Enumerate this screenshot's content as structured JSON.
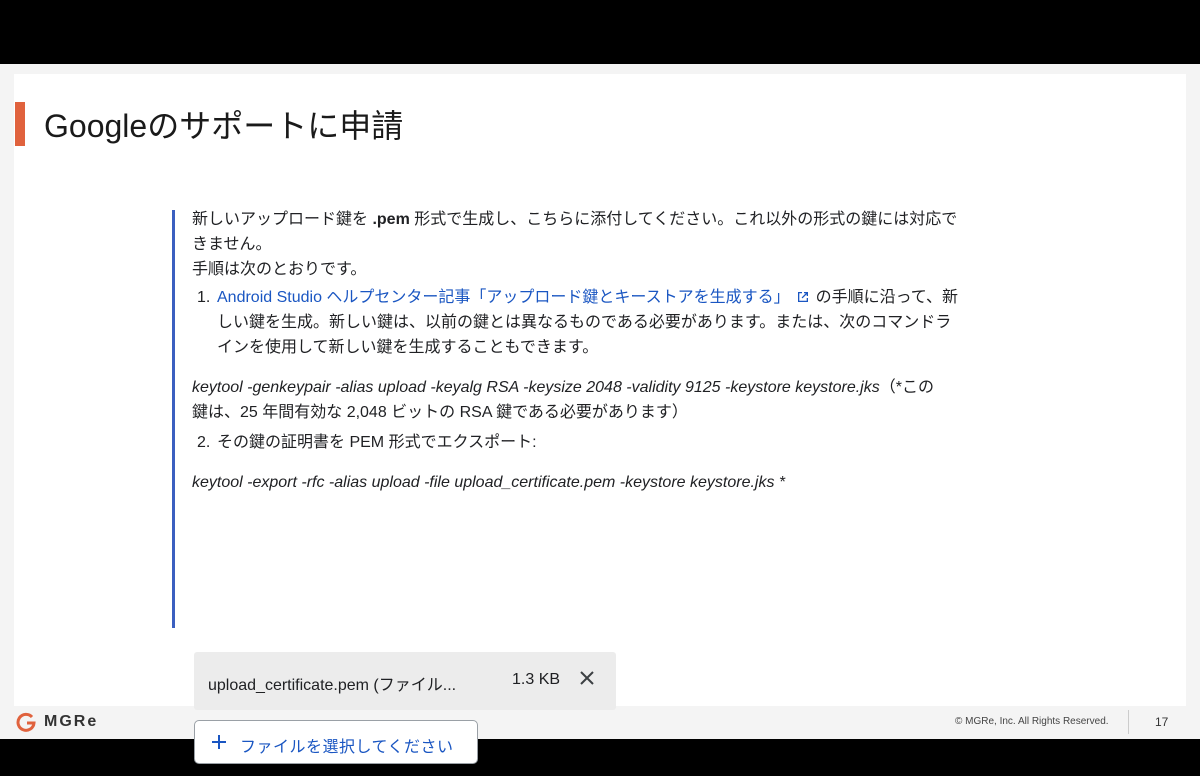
{
  "slide": {
    "title": "Googleのサポートに申請",
    "accent_color": "#e0623d",
    "footer": {
      "logo_text": "MGRe",
      "copyright": "© MGRe, Inc. All Rights Reserved.",
      "page_number": "17"
    }
  },
  "form": {
    "intro_line1_a": "新しいアップロード鍵を ",
    "intro_line1_bold": ".pem",
    "intro_line1_b": " 形式で生成し、こちらに添付してください。これ以外の形式の鍵には対応で",
    "intro_line2": "きません。",
    "steps_heading": "手順は次のとおりです。",
    "step1": {
      "number": "1.",
      "link_text": "Android Studio ヘルプセンター記事「アップロード鍵とキーストアを生成する」",
      "link_icon": "external-link-icon",
      "text_after_link": "の手順に沿って、新",
      "line2": "しい鍵を生成。新しい鍵は、以前の鍵とは異なるものである必要があります。または、次のコマンドラ",
      "line3": "インを使用して新しい鍵を生成することもできます。"
    },
    "command1_a": "keytool -genkeypair -alias upload -keyalg RSA -keysize 2048 -validity 9125 -keystore keystore.jks",
    "command1_note_a": "（*この",
    "command1_note_b": "鍵は、25 年間有効な 2,048 ビットの RSA 鍵である必要があります）",
    "step2": {
      "number": "2.",
      "text": "その鍵の証明書を PEM 形式でエクスポート:"
    },
    "command2": "keytool -export -rfc -alias upload -file upload_certificate.pem -keystore keystore.jks *",
    "attached_file": {
      "name": "upload_certificate.pem (ファイル...",
      "size": "1.3 KB",
      "remove_icon": "close-icon"
    },
    "add_file_button": {
      "icon": "plus-icon",
      "label": "ファイルを選択してください"
    },
    "link_color": "#1a56c2",
    "border_color": "#3b5fc0"
  }
}
